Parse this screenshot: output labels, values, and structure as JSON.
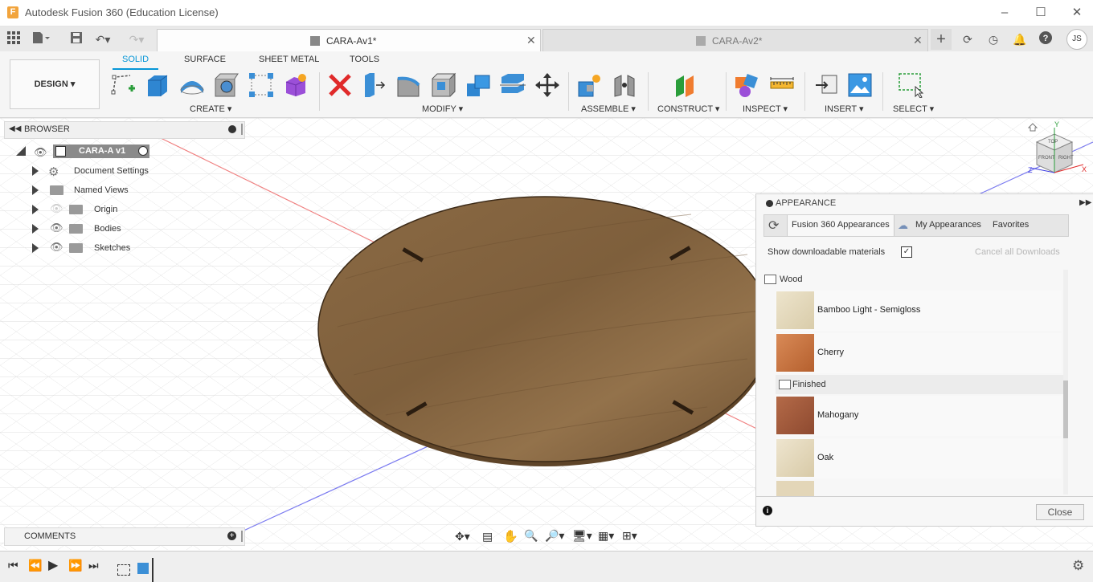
{
  "window": {
    "title": "Autodesk Fusion 360 (Education License)",
    "logo_letter": "F"
  },
  "tabs": [
    {
      "label": "CARA-Av1*",
      "active": true
    },
    {
      "label": "CARA-Av2*",
      "active": false
    }
  ],
  "user_initials": "JS",
  "workspace": {
    "label": "DESIGN"
  },
  "ribbon_tabs": [
    "SOLID",
    "SURFACE",
    "SHEET METAL",
    "TOOLS"
  ],
  "ribbon_groups": [
    "CREATE",
    "MODIFY",
    "ASSEMBLE",
    "CONSTRUCT",
    "INSPECT",
    "INSERT",
    "SELECT"
  ],
  "browser": {
    "title": "BROWSER",
    "root": "CARA-A v1",
    "items": [
      "Document Settings",
      "Named Views",
      "Origin",
      "Bodies",
      "Sketches"
    ]
  },
  "appearance": {
    "title": "APPEARANCE",
    "tabs": [
      "Fusion 360 Appearances",
      "My Appearances",
      "Favorites"
    ],
    "show_downloadable": "Show downloadable materials",
    "cancel_downloads": "Cancel all Downloads",
    "category": "Wood",
    "subcategory": "Finished",
    "materials": [
      "Bamboo Light - Semigloss",
      "Cherry",
      "Mahogany",
      "Oak"
    ],
    "close": "Close"
  },
  "comments": {
    "title": "COMMENTS"
  },
  "viewcube": {
    "top": "TOP",
    "front": "FRONT",
    "right": "RIGHT",
    "x": "X",
    "y": "Y",
    "z": "Z"
  },
  "colors": {
    "accent": "#0696d7",
    "wood": "#8a6840"
  }
}
